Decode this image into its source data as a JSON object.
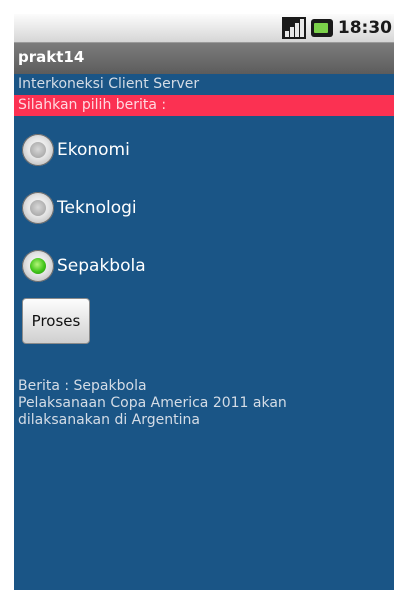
{
  "status_bar": {
    "time": "18:30",
    "icons": [
      "signal-icon",
      "battery-icon"
    ]
  },
  "app": {
    "title": "prakt14"
  },
  "content": {
    "heading": "Interkoneksi Client Server",
    "prompt": "Silahkan pilih berita :",
    "options": [
      {
        "label": "Ekonomi",
        "checked": false
      },
      {
        "label": "Teknologi",
        "checked": false
      },
      {
        "label": "Sepakbola",
        "checked": true
      }
    ],
    "button_label": "Proses",
    "result_lines": [
      "Berita : Sepakbola",
      "Pelaksanaan Copa America 2011 akan",
      "dilaksanakan di Argentina"
    ]
  },
  "colors": {
    "background": "#1a5586",
    "prompt_bar": "#fb3152",
    "radio_checked": "#42c51a"
  }
}
